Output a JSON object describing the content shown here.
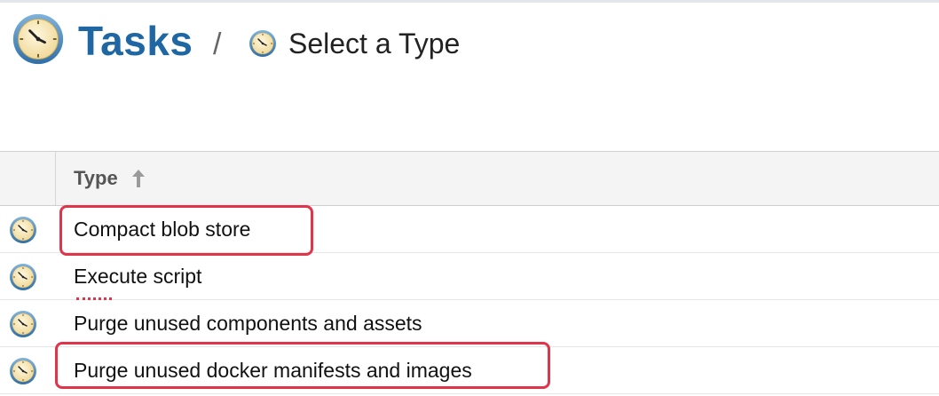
{
  "header": {
    "title": "Tasks",
    "separator": "/",
    "subtitle": "Select a Type",
    "icon": "clock-icon"
  },
  "table": {
    "columns": [
      {
        "label": "Type",
        "sort": "ascending",
        "sort_icon": "arrow-up-icon"
      }
    ],
    "rows": [
      {
        "label": "Compact blob store",
        "icon": "clock-icon",
        "highlighted": true
      },
      {
        "label": "Execute script",
        "icon": "clock-icon",
        "highlighted": false
      },
      {
        "label": "Purge unused components and assets",
        "icon": "clock-icon",
        "highlighted": false
      },
      {
        "label": "Purge unused docker manifests and images",
        "icon": "clock-icon",
        "highlighted": true
      }
    ]
  },
  "colors": {
    "title": "#1f67a3",
    "highlight": "#e0344b",
    "header_bg": "#f4f4f4"
  }
}
